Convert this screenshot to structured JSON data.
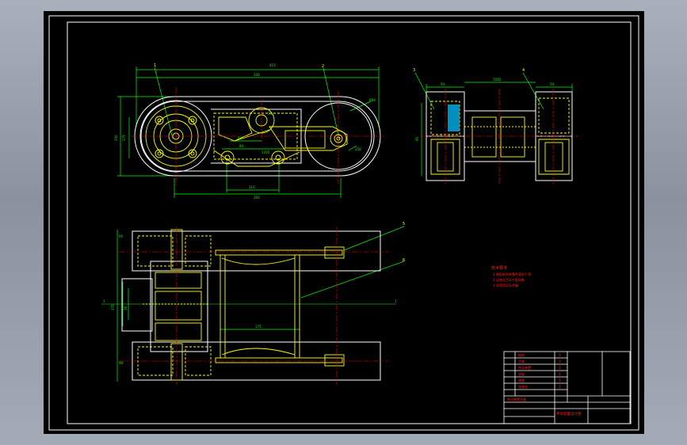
{
  "colors": {
    "background": "#000000",
    "outline": "#ffffff",
    "parts": "#ffff00",
    "dimensions": "#00ff00",
    "centerlines": "#ff0000",
    "labels": "#ff2020",
    "section_hatch": "#00c0ff"
  },
  "views": {
    "front": {
      "leaders": [
        "1",
        "2"
      ],
      "dims": [
        "410",
        "330",
        "260",
        "150",
        "175",
        "60",
        "1355",
        "110",
        "250",
        "R84",
        "84",
        "34"
      ]
    },
    "side": {
      "leaders": [
        "3",
        "4"
      ],
      "dims": [
        "50",
        "50",
        "1015",
        "95"
      ]
    },
    "top": {
      "leaders": [
        "5",
        "6"
      ],
      "dims": [
        "1",
        "1",
        "175",
        "36",
        "175",
        "90",
        "95"
      ]
    }
  },
  "notes": {
    "title": "技术要求",
    "lines": [
      "1.装配前所有零件清洗干净",
      "2.运转灵活无卡阻现象",
      "3.润滑良好无渗漏"
    ]
  },
  "title_block": {
    "parts_list": [
      "链轮",
      "主轴",
      "传动装置",
      "支架",
      "底座",
      "张紧轮"
    ],
    "qty": [
      "1",
      "1",
      "1",
      "2",
      "1",
      "1"
    ],
    "drawing_name": "传动装置总图",
    "footer": "传动装置设计图"
  }
}
